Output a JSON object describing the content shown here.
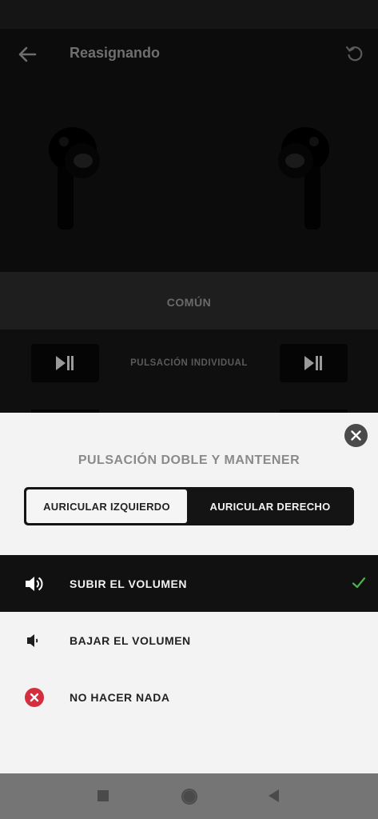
{
  "appbar": {
    "title": "Reasignando"
  },
  "common": {
    "label": "COMÚN"
  },
  "single_press": {
    "label": "PULSACIÓN INDIVIDUAL"
  },
  "sheet": {
    "heading": "PULSACIÓN DOBLE Y MANTENER",
    "tabs": {
      "left": "AURICULAR IZQUIERDO",
      "right": "AURICULAR DERECHO",
      "selected": "left"
    },
    "options": [
      {
        "label": "SUBIR EL VOLUMEN",
        "icon": "volume-up-icon",
        "selected": true
      },
      {
        "label": "BAJAR EL VOLUMEN",
        "icon": "volume-down-icon",
        "selected": false
      },
      {
        "label": "NO HACER NADA",
        "icon": "none-x-icon",
        "selected": false
      }
    ]
  },
  "colors": {
    "check": "#4caf50",
    "none": "#d32f3f",
    "sheet_bg": "#f3f3f3",
    "dark_bg": "#0c0c0c"
  }
}
